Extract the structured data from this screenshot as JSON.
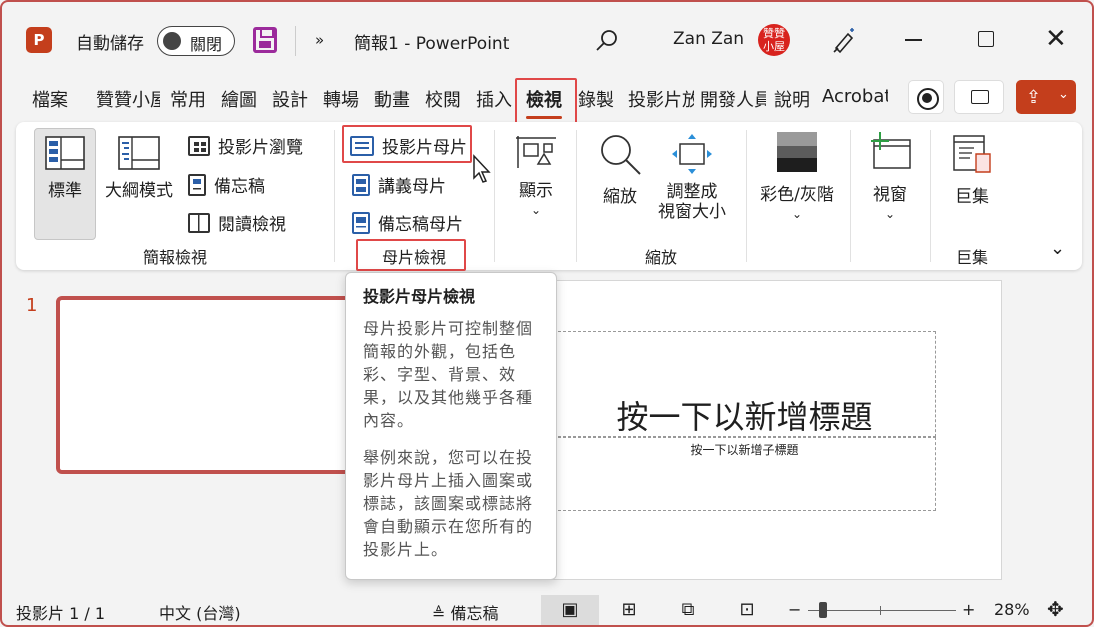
{
  "titlebar": {
    "app_logo": "P",
    "autosave_label": "自動儲存",
    "autosave_state": "關閉",
    "more": "»",
    "doc_title": "簡報1  -  PowerPoint",
    "user_name": "Zan Zan",
    "avatar_text": "贊贊小屋"
  },
  "tabs": [
    "檔案",
    "贊贊小屋",
    "常用",
    "繪圖",
    "設計",
    "轉場",
    "動畫",
    "校閱",
    "插入",
    "檢視",
    "錄製",
    "投影片放映",
    "開發人員",
    "說明",
    "Acrobat"
  ],
  "active_tab": "檢視",
  "ribbon": {
    "presentation_views": {
      "label": "簡報檢視",
      "normal": "標準",
      "outline": "大綱模式",
      "slide_sorter": "投影片瀏覽",
      "notes_page": "備忘稿",
      "reading_view": "閱讀檢視"
    },
    "master_views": {
      "label": "母片檢視",
      "slide_master": "投影片母片",
      "handout_master": "講義母片",
      "notes_master": "備忘稿母片"
    },
    "show": {
      "label": "顯示"
    },
    "zoom": {
      "label": "縮放",
      "zoom": "縮放",
      "fit_line1": "調整成",
      "fit_line2": "視窗大小"
    },
    "color": {
      "label": "彩色/灰階"
    },
    "window": {
      "label": "視窗"
    },
    "macros": {
      "label": "巨集",
      "button": "巨集"
    }
  },
  "tooltip": {
    "title": "投影片母片檢視",
    "para1": "母片投影片可控制整個簡報的外觀，包括色彩、字型、背景、效果，以及其他幾乎各種內容。",
    "para2": "舉例來說，您可以在投影片母片上插入圖案或標誌，該圖案或標誌將會自動顯示在您所有的投影片上。"
  },
  "slide": {
    "thumb_number": "1",
    "title_placeholder": "按一下以新增標題",
    "subtitle_placeholder": "按一下以新增子標題"
  },
  "statusbar": {
    "slide_info": "投影片 1 / 1",
    "language": "中文 (台灣)",
    "notes": "備忘稿",
    "zoom_level": "28%",
    "zoom_minus": "−",
    "zoom_plus": "+"
  },
  "colors": {
    "accent": "#c43e1c",
    "highlight": "#e04848"
  }
}
